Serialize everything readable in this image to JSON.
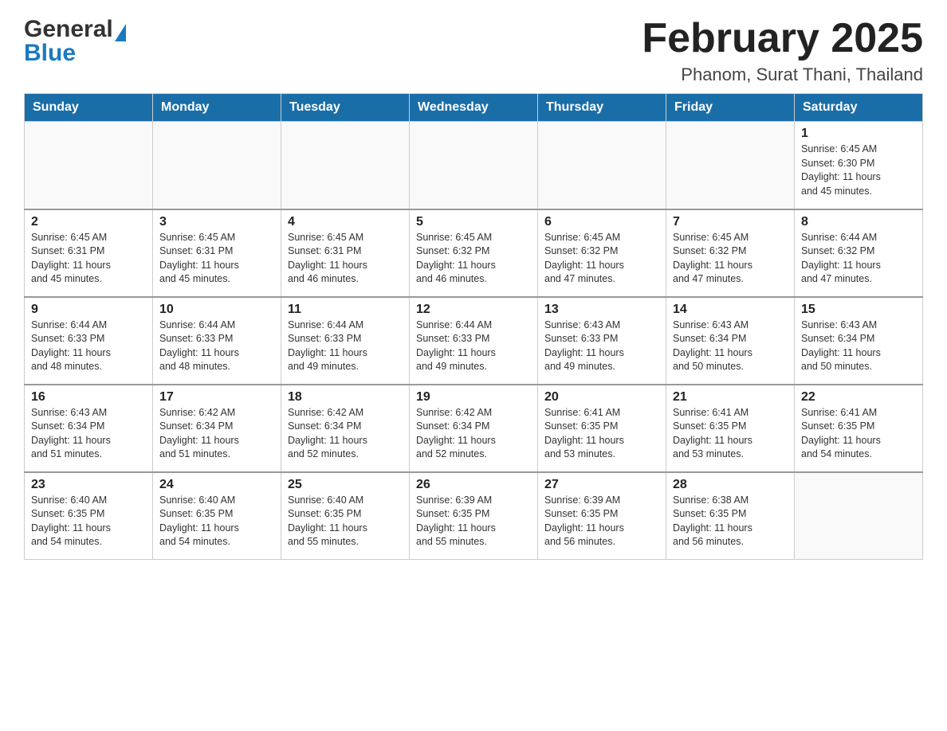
{
  "header": {
    "logo_general": "General",
    "logo_blue": "Blue",
    "month_title": "February 2025",
    "subtitle": "Phanom, Surat Thani, Thailand"
  },
  "days_of_week": [
    "Sunday",
    "Monday",
    "Tuesday",
    "Wednesday",
    "Thursday",
    "Friday",
    "Saturday"
  ],
  "weeks": [
    [
      {
        "day": "",
        "info": ""
      },
      {
        "day": "",
        "info": ""
      },
      {
        "day": "",
        "info": ""
      },
      {
        "day": "",
        "info": ""
      },
      {
        "day": "",
        "info": ""
      },
      {
        "day": "",
        "info": ""
      },
      {
        "day": "1",
        "info": "Sunrise: 6:45 AM\nSunset: 6:30 PM\nDaylight: 11 hours\nand 45 minutes."
      }
    ],
    [
      {
        "day": "2",
        "info": "Sunrise: 6:45 AM\nSunset: 6:31 PM\nDaylight: 11 hours\nand 45 minutes."
      },
      {
        "day": "3",
        "info": "Sunrise: 6:45 AM\nSunset: 6:31 PM\nDaylight: 11 hours\nand 45 minutes."
      },
      {
        "day": "4",
        "info": "Sunrise: 6:45 AM\nSunset: 6:31 PM\nDaylight: 11 hours\nand 46 minutes."
      },
      {
        "day": "5",
        "info": "Sunrise: 6:45 AM\nSunset: 6:32 PM\nDaylight: 11 hours\nand 46 minutes."
      },
      {
        "day": "6",
        "info": "Sunrise: 6:45 AM\nSunset: 6:32 PM\nDaylight: 11 hours\nand 47 minutes."
      },
      {
        "day": "7",
        "info": "Sunrise: 6:45 AM\nSunset: 6:32 PM\nDaylight: 11 hours\nand 47 minutes."
      },
      {
        "day": "8",
        "info": "Sunrise: 6:44 AM\nSunset: 6:32 PM\nDaylight: 11 hours\nand 47 minutes."
      }
    ],
    [
      {
        "day": "9",
        "info": "Sunrise: 6:44 AM\nSunset: 6:33 PM\nDaylight: 11 hours\nand 48 minutes."
      },
      {
        "day": "10",
        "info": "Sunrise: 6:44 AM\nSunset: 6:33 PM\nDaylight: 11 hours\nand 48 minutes."
      },
      {
        "day": "11",
        "info": "Sunrise: 6:44 AM\nSunset: 6:33 PM\nDaylight: 11 hours\nand 49 minutes."
      },
      {
        "day": "12",
        "info": "Sunrise: 6:44 AM\nSunset: 6:33 PM\nDaylight: 11 hours\nand 49 minutes."
      },
      {
        "day": "13",
        "info": "Sunrise: 6:43 AM\nSunset: 6:33 PM\nDaylight: 11 hours\nand 49 minutes."
      },
      {
        "day": "14",
        "info": "Sunrise: 6:43 AM\nSunset: 6:34 PM\nDaylight: 11 hours\nand 50 minutes."
      },
      {
        "day": "15",
        "info": "Sunrise: 6:43 AM\nSunset: 6:34 PM\nDaylight: 11 hours\nand 50 minutes."
      }
    ],
    [
      {
        "day": "16",
        "info": "Sunrise: 6:43 AM\nSunset: 6:34 PM\nDaylight: 11 hours\nand 51 minutes."
      },
      {
        "day": "17",
        "info": "Sunrise: 6:42 AM\nSunset: 6:34 PM\nDaylight: 11 hours\nand 51 minutes."
      },
      {
        "day": "18",
        "info": "Sunrise: 6:42 AM\nSunset: 6:34 PM\nDaylight: 11 hours\nand 52 minutes."
      },
      {
        "day": "19",
        "info": "Sunrise: 6:42 AM\nSunset: 6:34 PM\nDaylight: 11 hours\nand 52 minutes."
      },
      {
        "day": "20",
        "info": "Sunrise: 6:41 AM\nSunset: 6:35 PM\nDaylight: 11 hours\nand 53 minutes."
      },
      {
        "day": "21",
        "info": "Sunrise: 6:41 AM\nSunset: 6:35 PM\nDaylight: 11 hours\nand 53 minutes."
      },
      {
        "day": "22",
        "info": "Sunrise: 6:41 AM\nSunset: 6:35 PM\nDaylight: 11 hours\nand 54 minutes."
      }
    ],
    [
      {
        "day": "23",
        "info": "Sunrise: 6:40 AM\nSunset: 6:35 PM\nDaylight: 11 hours\nand 54 minutes."
      },
      {
        "day": "24",
        "info": "Sunrise: 6:40 AM\nSunset: 6:35 PM\nDaylight: 11 hours\nand 54 minutes."
      },
      {
        "day": "25",
        "info": "Sunrise: 6:40 AM\nSunset: 6:35 PM\nDaylight: 11 hours\nand 55 minutes."
      },
      {
        "day": "26",
        "info": "Sunrise: 6:39 AM\nSunset: 6:35 PM\nDaylight: 11 hours\nand 55 minutes."
      },
      {
        "day": "27",
        "info": "Sunrise: 6:39 AM\nSunset: 6:35 PM\nDaylight: 11 hours\nand 56 minutes."
      },
      {
        "day": "28",
        "info": "Sunrise: 6:38 AM\nSunset: 6:35 PM\nDaylight: 11 hours\nand 56 minutes."
      },
      {
        "day": "",
        "info": ""
      }
    ]
  ]
}
